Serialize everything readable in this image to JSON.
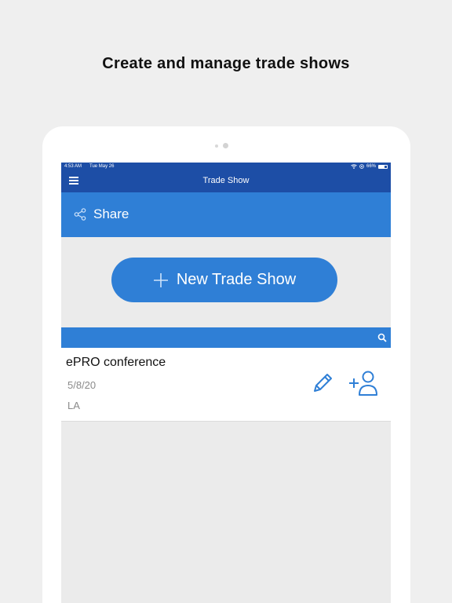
{
  "headline": "Create and manage trade shows",
  "status": {
    "time": "4:53 AM",
    "date": "Tue May 26",
    "battery": "66%",
    "battery_level": 0.66
  },
  "nav": {
    "title": "Trade Show",
    "menu_icon": "hamburger-icon"
  },
  "share": {
    "label": "Share",
    "icon": "share-icon"
  },
  "new_button": {
    "label": "New Trade Show",
    "icon": "plus-icon"
  },
  "search": {
    "icon": "search-icon"
  },
  "trade_shows": [
    {
      "name": "ePRO conference",
      "date": "5/8/20",
      "location": "LA"
    }
  ],
  "colors": {
    "nav_blue": "#1d4ea6",
    "accent_blue": "#2f7fd6",
    "background": "#efefef"
  }
}
